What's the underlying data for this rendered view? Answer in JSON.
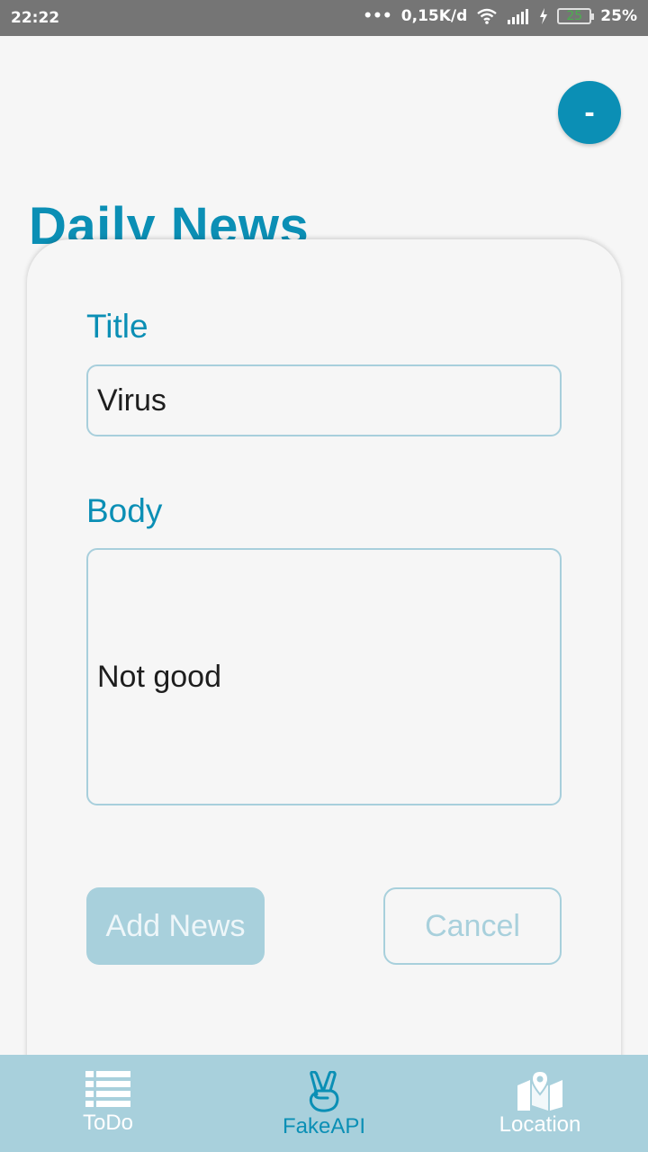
{
  "status_bar": {
    "time": "22:22",
    "dots": "•••",
    "network_speed": "0,15K/d",
    "battery_level": "25",
    "battery_percent": "25%",
    "icons": [
      "wifi-icon",
      "signal-icon",
      "charging-icon",
      "battery-icon"
    ]
  },
  "fab": {
    "label": "-"
  },
  "header": {
    "title": "Daily News"
  },
  "form": {
    "title_label": "Title",
    "title_value": "Virus",
    "body_label": "Body",
    "body_value": "Not good",
    "add_button": "Add News",
    "cancel_button": "Cancel"
  },
  "bottom_nav": {
    "items": [
      {
        "label": "ToDo",
        "icon": "list-icon",
        "active": false
      },
      {
        "label": "FakeAPI",
        "icon": "peace-hand-icon",
        "active": true
      },
      {
        "label": "Location",
        "icon": "map-pin-icon",
        "active": false
      }
    ]
  },
  "colors": {
    "accent": "#0b8fb5",
    "light_accent": "#a8d0dc",
    "background": "#f6f6f6",
    "status_bar": "#757575"
  }
}
